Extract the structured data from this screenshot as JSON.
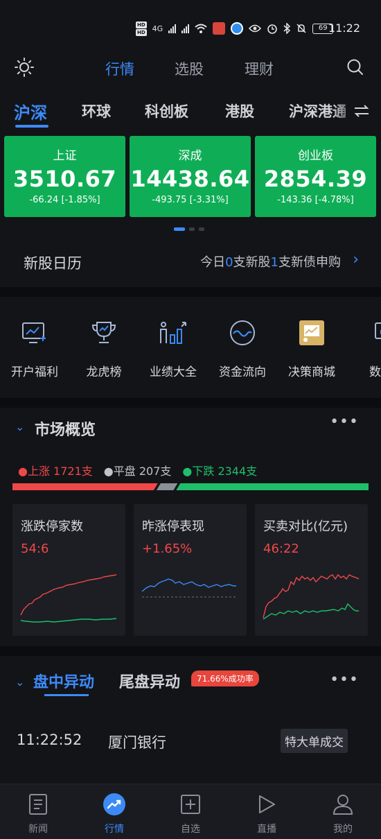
{
  "status_bar": {
    "time": "11:22",
    "battery": "69",
    "network": "4G",
    "hd1": "HD",
    "hd2": "HD"
  },
  "top_nav": {
    "tabs": [
      "行情",
      "选股",
      "理财"
    ],
    "active_tab": "行情"
  },
  "market_tabs": {
    "tabs": [
      "沪深",
      "环球",
      "科创板",
      "港股",
      "沪深港通"
    ],
    "active": "沪深"
  },
  "indices": [
    {
      "name": "上证",
      "value": "3510.67",
      "change": "-66.24",
      "pct": "[-1.85%]"
    },
    {
      "name": "深成",
      "value": "14438.64",
      "change": "-493.75",
      "pct": "[-3.31%]"
    },
    {
      "name": "创业板",
      "value": "2854.39",
      "change": "-143.36",
      "pct": "[-4.78%]"
    }
  ],
  "ipo_calendar": {
    "title": "新股日历",
    "prefix": "今日",
    "new_stocks": "0",
    "mid": "支新股",
    "new_bonds": "1",
    "suffix": "支新债申购"
  },
  "tools": [
    {
      "label": "开户福利",
      "icon": "account-open-icon"
    },
    {
      "label": "龙虎榜",
      "icon": "trophy-icon"
    },
    {
      "label": "业绩大全",
      "icon": "performance-icon"
    },
    {
      "label": "资金流向",
      "icon": "capital-flow-icon"
    },
    {
      "label": "决策商城",
      "icon": "decision-mall-icon"
    },
    {
      "label": "数据",
      "icon": "data-icon"
    }
  ],
  "market_overview": {
    "title": "市场概览",
    "up_label": "上涨 1721支",
    "flat_label": "平盘 207支",
    "down_label": "下跌 2344支",
    "up_count": 1721,
    "flat_count": 207,
    "down_count": 2344,
    "cards": [
      {
        "title": "涨跌停家数",
        "value": "54:6"
      },
      {
        "title": "昨涨停表现",
        "value": "+1.65%"
      },
      {
        "title": "买卖对比(亿元)",
        "value": "46:22"
      }
    ]
  },
  "movers": {
    "tab_active": "盘中异动",
    "tab_other": "尾盘异动",
    "badge": "71.66%成功率",
    "rows": [
      {
        "time": "11:22:52",
        "name": "厦门银行",
        "tag": "特大单成交"
      }
    ]
  },
  "bottom_nav": {
    "items": [
      "新闻",
      "行情",
      "自选",
      "直播",
      "我的"
    ],
    "active": "行情"
  },
  "colors": {
    "accent": "#3d8af7",
    "up": "#f04848",
    "down": "#1fbf6a",
    "card_green": "#0fae56"
  }
}
